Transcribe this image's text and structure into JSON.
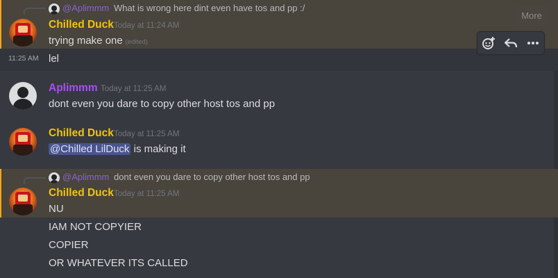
{
  "messages": [
    {
      "reply": {
        "name": "@Aplimmm",
        "text": "What is wrong here dint even have tos and pp :/"
      },
      "author": "Chilled Duck",
      "time": "Today at 11:24 AM",
      "lines": [
        {
          "text": "trying make one",
          "edited": "(edited)"
        }
      ]
    },
    {
      "side_time": "11:25 AM",
      "text": "lel"
    },
    {
      "author": "Aplimmm",
      "time": "Today at 11:25 AM",
      "lines": [
        {
          "text": "dont even you dare to copy other host tos and pp"
        }
      ]
    },
    {
      "author": "Chilled Duck",
      "time": "Today at 11:25 AM",
      "mention": "@Chilled LilDuck",
      "after_mention": " is making it"
    },
    {
      "reply": {
        "name": "@Aplimmm",
        "text": "dont even you dare to copy other host tos and pp"
      },
      "author": "Chilled Duck",
      "time": "Today at 11:25 AM",
      "lines": [
        {
          "text": "NU"
        },
        {
          "text": "IAM NOT COPYIER"
        },
        {
          "text": "COPIER"
        },
        {
          "text": "OR WHATEVER ITS CALLED"
        }
      ]
    }
  ],
  "toolbar": {
    "more_label": "More"
  },
  "icons": {
    "reaction": "add-reaction-icon",
    "reply": "reply-icon",
    "more": "more-dots-icon"
  },
  "colors": {
    "highlight": "#49443c",
    "duck": "#f1c40f",
    "aplimmm": "#a84ff0",
    "background": "#36393f"
  }
}
